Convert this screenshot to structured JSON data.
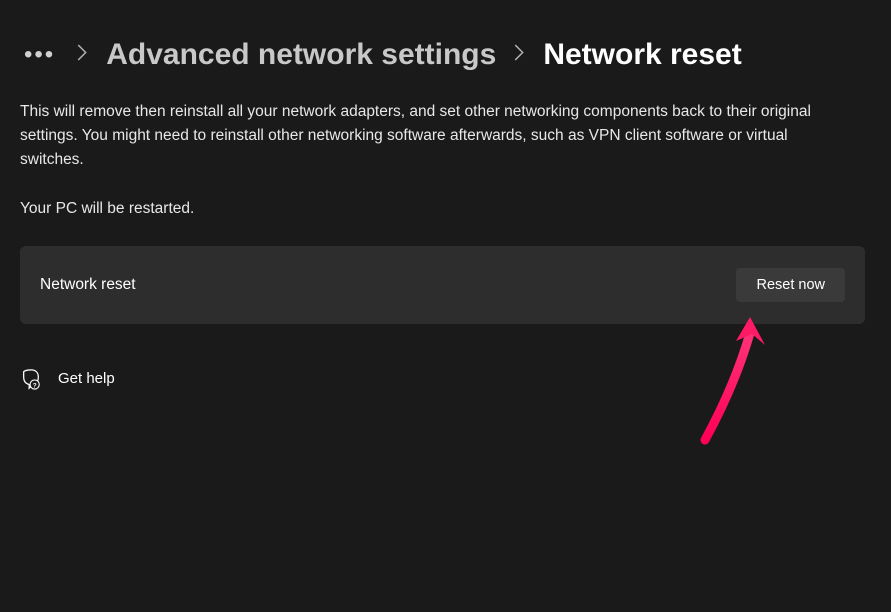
{
  "breadcrumb": {
    "ellipsis": "•••",
    "parent": "Advanced network settings",
    "current": "Network reset"
  },
  "body": {
    "description": "This will remove then reinstall all your network adapters, and set other networking components back to their original settings. You might need to reinstall other networking software afterwards, such as VPN client software or virtual switches.",
    "restart_note": "Your PC will be restarted."
  },
  "card": {
    "label": "Network reset",
    "button": "Reset now"
  },
  "help": {
    "label": "Get help"
  }
}
